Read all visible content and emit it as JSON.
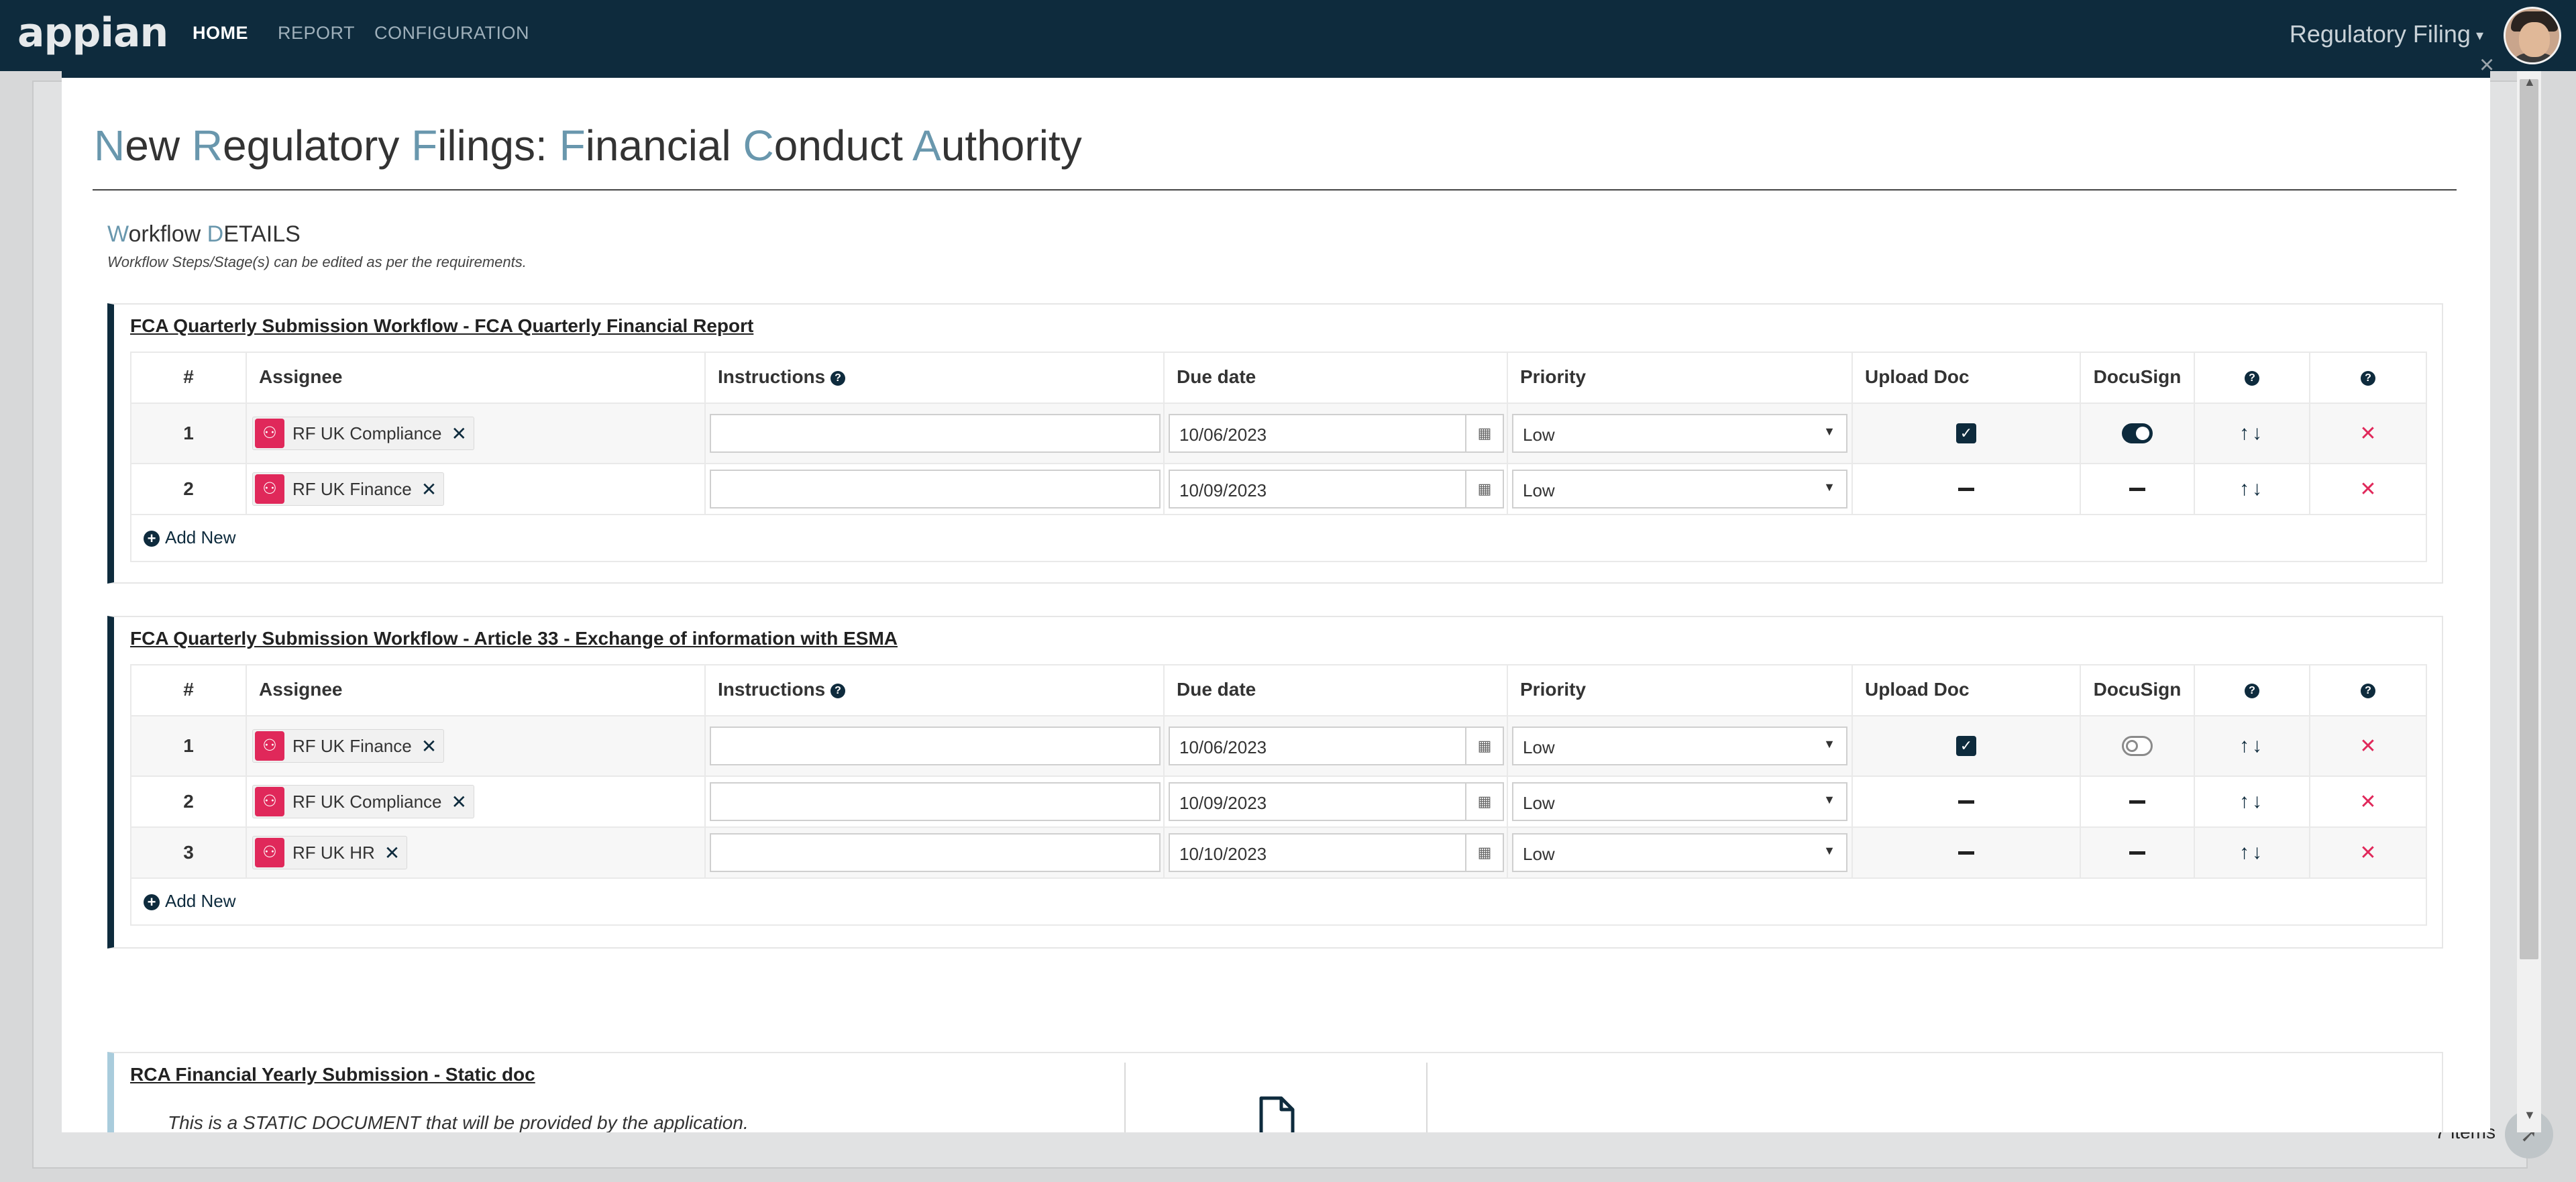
{
  "topnav": {
    "logo": "appian",
    "links": [
      "HOME",
      "REPORT",
      "CONFIGURATION"
    ],
    "app_switcher": "Regulatory Filing",
    "caret": "▾"
  },
  "background": {
    "items_count": "7 items"
  },
  "modal": {
    "close": "×",
    "title_parts": [
      {
        "cap": "N",
        "rest": "ew "
      },
      {
        "cap": "R",
        "rest": "egulatory "
      },
      {
        "cap": "F",
        "rest": "ilings: "
      },
      {
        "cap": "F",
        "rest": "inancial "
      },
      {
        "cap": "C",
        "rest": "onduct "
      },
      {
        "cap": "A",
        "rest": "uthority"
      }
    ],
    "workflow_heading": {
      "cap1": "W",
      "rest1": "orkflow ",
      "cap2": "D",
      "rest2": "ETAILS"
    },
    "workflow_subtext": "Workflow Steps/Stage(s) can be edited as per the requirements.",
    "columns": {
      "num": "#",
      "assignee": "Assignee",
      "instructions": "Instructions",
      "due_date": "Due date",
      "priority": "Priority",
      "upload_doc": "Upload Doc",
      "docusign": "DocuSign"
    },
    "add_new": "Add New",
    "workflows": [
      {
        "title": "FCA Quarterly Submission Workflow - FCA Quarterly Financial Report ",
        "rows": [
          {
            "num": "1",
            "assignee": "RF UK Compliance",
            "instructions": "",
            "due": "10/06/2023",
            "priority": "Low",
            "upload": "checked",
            "docusign": "on"
          },
          {
            "num": "2",
            "assignee": "RF UK Finance",
            "instructions": "",
            "due": "10/09/2023",
            "priority": "Low",
            "upload": "none",
            "docusign": "none"
          }
        ]
      },
      {
        "title": "FCA Quarterly Submission Workflow - Article 33 - Exchange of information with ESMA",
        "rows": [
          {
            "num": "1",
            "assignee": "RF UK Finance",
            "instructions": "",
            "due": "10/06/2023",
            "priority": "Low",
            "upload": "checked",
            "docusign": "off"
          },
          {
            "num": "2",
            "assignee": "RF UK Compliance",
            "instructions": "",
            "due": "10/09/2023",
            "priority": "Low",
            "upload": "none",
            "docusign": "none"
          },
          {
            "num": "3",
            "assignee": "RF UK HR",
            "instructions": "",
            "due": "10/10/2023",
            "priority": "Low",
            "upload": "none",
            "docusign": "none"
          }
        ]
      }
    ],
    "static_doc": {
      "title": "RCA Financial Yearly Submission - Static doc",
      "text": "This is a STATIC DOCUMENT that will be provided by the application."
    }
  },
  "icons": {
    "group": "group-icon",
    "remove": "close-icon",
    "calendar": "calendar-icon",
    "dropdown": "chevron-down-icon",
    "move": "arrow-up-down-icon",
    "delete": "delete-x-icon",
    "help": "question-icon",
    "document": "document-icon"
  },
  "colors": {
    "nav": "#0e2b3d",
    "accent_cap": "#6997ad",
    "chip_icon": "#e0285a",
    "delete": "#e0285a"
  }
}
